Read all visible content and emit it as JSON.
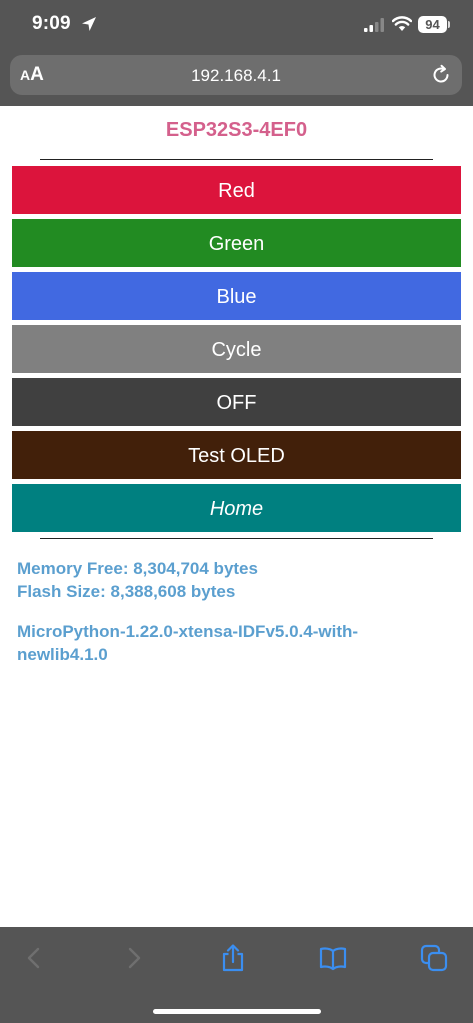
{
  "status_bar": {
    "time": "9:09",
    "battery_level": "94",
    "icons": [
      "location-arrow-icon",
      "cellular-signal-icon",
      "wifi-icon",
      "battery-icon"
    ]
  },
  "browser": {
    "text_size_label_small": "A",
    "text_size_label_large": "A",
    "url": "192.168.4.1",
    "reload_icon": "reload-icon"
  },
  "page": {
    "title": "ESP32S3-4EF0",
    "title_color": "#d4608c",
    "buttons": [
      {
        "label": "Red",
        "color": "#dc143c"
      },
      {
        "label": "Green",
        "color": "#228b22"
      },
      {
        "label": "Blue",
        "color": "#4169e1"
      },
      {
        "label": "Cycle",
        "color": "#808080"
      },
      {
        "label": "OFF",
        "color": "#404040"
      },
      {
        "label": "Test OLED",
        "color": "#42200a"
      },
      {
        "label": "Home",
        "color": "#008080"
      }
    ],
    "memory_free": "Memory Free: 8,304,704 bytes",
    "flash_size": "Flash Size: 8,388,608 bytes",
    "version": "MicroPython-1.22.0-xtensa-IDFv5.0.4-with-newlib4.1.0",
    "info_color": "#5b9fcf"
  },
  "toolbar": {
    "icons": [
      "back-icon",
      "forward-icon",
      "share-icon",
      "bookmarks-icon",
      "tabs-icon"
    ],
    "back_enabled": false,
    "forward_enabled": false
  }
}
